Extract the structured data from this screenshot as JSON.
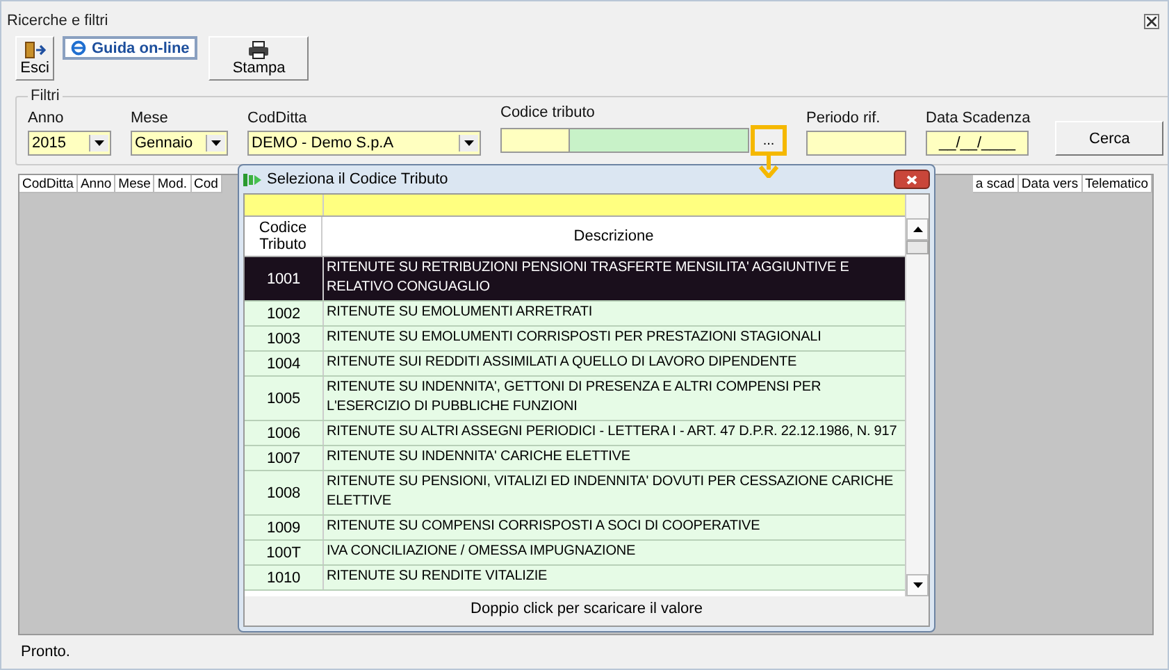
{
  "window": {
    "title": "Ricerche e filtri"
  },
  "toolbar": [
    {
      "kind": "exit",
      "label": "Esci"
    },
    {
      "kind": "help",
      "label": "Guida on-line"
    },
    {
      "kind": "print",
      "label": "Stampa"
    }
  ],
  "filters": {
    "title": "Filtri",
    "anno": {
      "label": "Anno",
      "value": "2015"
    },
    "mese": {
      "label": "Mese",
      "value": "Gennaio"
    },
    "codditta": {
      "label": "CodDitta",
      "value": "DEMO - Demo S.p.A"
    },
    "codice_tributo": {
      "label": "Codice tributo",
      "browse_label": "...",
      "highlighted": true
    },
    "periodo": {
      "label": "Periodo rif."
    },
    "scadenza": {
      "label": "Data Scadenza",
      "value": "__/__/____"
    },
    "search_button": "Cerca"
  },
  "grid": {
    "columns_left": [
      "CodDitta",
      "Anno",
      "Mese",
      "Mod.",
      "Cod"
    ],
    "columns_right": [
      "a scad",
      "Data vers",
      "Telematico"
    ]
  },
  "dialog": {
    "title": "Seleziona il Codice Tributo",
    "columns": [
      "Codice Tributo",
      "Descrizione"
    ],
    "rows": [
      {
        "code": "1001",
        "description": "RITENUTE SU RETRIBUZIONI  PENSIONI TRASFERTE MENSILITA' AGGIUNTIVE E RELATIVO CONGUAGLIO",
        "selected": true
      },
      {
        "code": "1002",
        "description": "RITENUTE SU EMOLUMENTI ARRETRATI",
        "selected": false
      },
      {
        "code": "1003",
        "description": "RITENUTE SU EMOLUMENTI CORRISPOSTI PER PRESTAZIONI STAGIONALI",
        "selected": false
      },
      {
        "code": "1004",
        "description": "RITENUTE SUI REDDITI ASSIMILATI A QUELLO DI LAVORO DIPENDENTE",
        "selected": false
      },
      {
        "code": "1005",
        "description": "RITENUTE SU INDENNITA', GETTONI DI PRESENZA E ALTRI COMPENSI PER L'ESERCIZIO DI PUBBLICHE FUNZIONI",
        "selected": false
      },
      {
        "code": "1006",
        "description": "RITENUTE SU ALTRI ASSEGNI PERIODICI - LETTERA I - ART. 47 D.P.R. 22.12.1986, N. 917",
        "selected": false
      },
      {
        "code": "1007",
        "description": "RITENUTE SU INDENNITA' CARICHE ELETTIVE",
        "selected": false
      },
      {
        "code": "1008",
        "description": "RITENUTE SU PENSIONI, VITALIZI ED INDENNITA' DOVUTI PER CESSAZIONE CARICHE ELETTIVE",
        "selected": false
      },
      {
        "code": "1009",
        "description": "RITENUTE SU COMPENSI CORRISPOSTI A SOCI DI COOPERATIVE",
        "selected": false
      },
      {
        "code": "100T",
        "description": "IVA CONCILIAZIONE /  OMESSA IMPUGNAZIONE",
        "selected": false
      },
      {
        "code": "1010",
        "description": "RITENUTE SU RENDITE VITALIZIE",
        "selected": false
      }
    ],
    "footer": "Doppio click per scaricare il valore"
  },
  "status_bar": "Pronto."
}
